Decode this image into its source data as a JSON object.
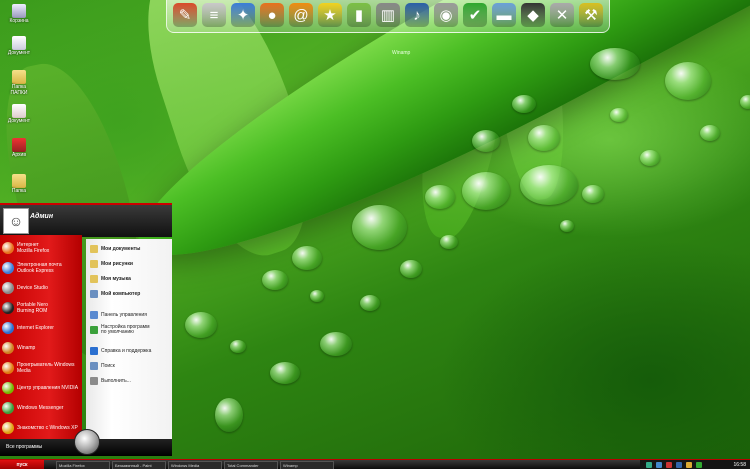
{
  "desktop": {
    "icons": [
      {
        "label": "Корзина",
        "icon": "recycle-bin-icon"
      },
      {
        "label": "Документ",
        "icon": "document-icon"
      },
      {
        "label": "Папка\nПАПКИ",
        "icon": "folder-icon"
      },
      {
        "label": "Документ",
        "icon": "document-icon"
      },
      {
        "label": "Архив",
        "icon": "archive-icon"
      },
      {
        "label": "Папка",
        "icon": "folder-icon"
      }
    ]
  },
  "dock": {
    "label": "Winamp",
    "items": [
      {
        "icon": "paint-icon",
        "color": "#d94a2a"
      },
      {
        "icon": "notepad-icon",
        "color": "#c9c9c9"
      },
      {
        "icon": "butterfly-icon",
        "color": "#3b7dd8"
      },
      {
        "icon": "firefox-icon",
        "color": "#e8711c"
      },
      {
        "icon": "mail-at-icon",
        "color": "#f08c10"
      },
      {
        "icon": "star-icon",
        "color": "#f2d21e"
      },
      {
        "icon": "gauge-icon",
        "color": "#7bc043"
      },
      {
        "icon": "equalizer-icon",
        "color": "#888888"
      },
      {
        "icon": "music-note-icon",
        "color": "#2a5fa8"
      },
      {
        "icon": "speaker-icon",
        "color": "#9a9a9a"
      },
      {
        "icon": "vlc-check-icon",
        "color": "#2ea82e"
      },
      {
        "icon": "folder-icon",
        "color": "#6aa0d8"
      },
      {
        "icon": "fox-icon",
        "color": "#333333"
      },
      {
        "icon": "tools-icon",
        "color": "#aaaaaa"
      },
      {
        "icon": "hammer-icon",
        "color": "#d8c020"
      }
    ]
  },
  "start_menu": {
    "user": "Админ",
    "left_items": [
      {
        "label": "Интернет\nMozilla Firefox",
        "icon": "firefox-icon",
        "color": "#e8711c"
      },
      {
        "label": "Электронная почта\nOutlook Express",
        "icon": "mail-icon",
        "color": "#3b7dd8"
      },
      {
        "label": "Device Studio",
        "icon": "device-icon",
        "color": "#888888"
      },
      {
        "label": "Portable Nero\nBurning ROM",
        "icon": "nero-icon",
        "color": "#222222"
      },
      {
        "label": "Internet Explorer",
        "icon": "ie-icon",
        "color": "#2a6fd0"
      },
      {
        "label": "Winamp",
        "icon": "winamp-icon",
        "color": "#d08020"
      },
      {
        "label": "Проигрыватель Windows Media",
        "icon": "media-player-icon",
        "color": "#e07a10"
      },
      {
        "label": "Центр управления NVIDIA",
        "icon": "nvidia-icon",
        "color": "#76b900"
      },
      {
        "label": "Windows Messenger",
        "icon": "messenger-icon",
        "color": "#3aa03a"
      },
      {
        "label": "Знакомство с Windows XP",
        "icon": "tour-icon",
        "color": "#e0a010"
      }
    ],
    "right_items": [
      {
        "label": "Мои документы",
        "icon": "folder-icon",
        "color": "#e2c35a"
      },
      {
        "label": "Мои рисунки",
        "icon": "folder-icon",
        "color": "#e2c35a"
      },
      {
        "label": "Моя музыка",
        "icon": "folder-icon",
        "color": "#e2c35a"
      },
      {
        "label": "Мой компьютер",
        "icon": "computer-icon",
        "color": "#6a8fc0"
      },
      {
        "label": "Панель управления",
        "icon": "control-panel-icon",
        "color": "#5a8ad0"
      },
      {
        "label": "Настройка программ\nпо умолчанию",
        "icon": "defaults-icon",
        "color": "#3aa03a"
      },
      {
        "label": "Справка и поддержка",
        "icon": "help-icon",
        "color": "#2a6fd0"
      },
      {
        "label": "Поиск",
        "icon": "search-icon",
        "color": "#6a8fc0"
      },
      {
        "label": "Выполнить...",
        "icon": "run-icon",
        "color": "#8a8a8a"
      }
    ],
    "all_programs": "Все программы"
  },
  "taskbar": {
    "start_label": "пуск",
    "tasks": [
      "Mozilla Firefox",
      "Безымянный - Paint",
      "Windows Media",
      "Total Commander",
      "Winamp"
    ],
    "clock": "16:58"
  }
}
